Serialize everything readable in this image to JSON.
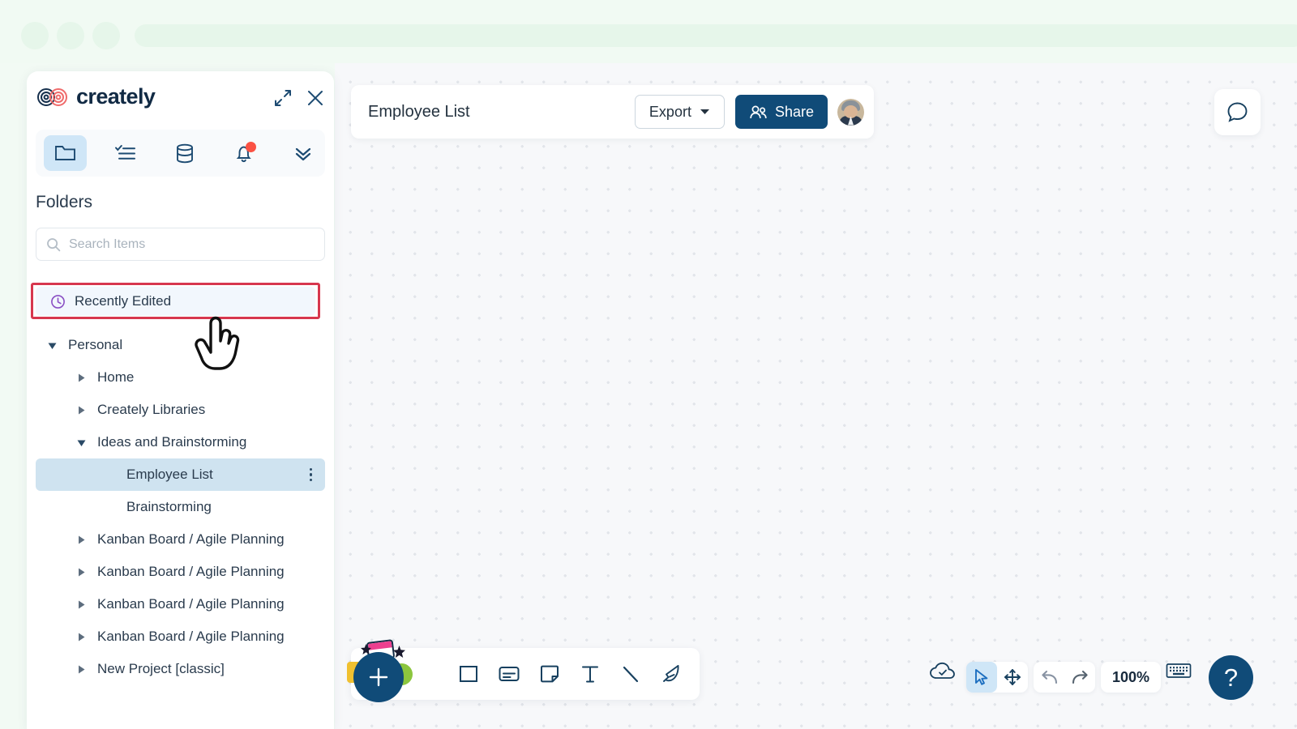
{
  "browser": {
    "dots": [
      "win-dot-1",
      "win-dot-2",
      "win-dot-3"
    ]
  },
  "panel": {
    "brand": "creately",
    "expand_icon": "expand-arrows-icon",
    "close_icon": "close-icon",
    "tabs": [
      {
        "name": "folder",
        "icon": "folder-icon",
        "active": true
      },
      {
        "name": "tasks",
        "icon": "task-list-icon",
        "active": false
      },
      {
        "name": "database",
        "icon": "database-icon",
        "active": false
      },
      {
        "name": "notifications",
        "icon": "bell-icon",
        "active": false,
        "badge": true
      },
      {
        "name": "more",
        "icon": "double-chevron-down-icon",
        "active": false
      }
    ],
    "section_title": "Folders",
    "search": {
      "placeholder": "Search Items",
      "value": "",
      "icon": "search-icon"
    },
    "recently_edited": {
      "label": "Recently Edited",
      "icon": "clock-icon",
      "highlighted": true
    },
    "tree": [
      {
        "label": "Personal",
        "indent": 0,
        "caret": "down",
        "selected": false,
        "menu": false
      },
      {
        "label": "Home",
        "indent": 1,
        "caret": "right",
        "selected": false,
        "menu": false
      },
      {
        "label": "Creately Libraries",
        "indent": 1,
        "caret": "right",
        "selected": false,
        "menu": false
      },
      {
        "label": "Ideas and Brainstorming",
        "indent": 1,
        "caret": "down",
        "selected": false,
        "menu": false
      },
      {
        "label": "Employee List",
        "indent": 2,
        "caret": "none",
        "selected": true,
        "menu": true
      },
      {
        "label": "Brainstorming",
        "indent": 2,
        "caret": "none",
        "selected": false,
        "menu": false
      },
      {
        "label": "Kanban Board / Agile Planning",
        "indent": 1,
        "caret": "right",
        "selected": false,
        "menu": false
      },
      {
        "label": "Kanban Board / Agile Planning",
        "indent": 1,
        "caret": "right",
        "selected": false,
        "menu": false
      },
      {
        "label": "Kanban Board / Agile Planning",
        "indent": 1,
        "caret": "right",
        "selected": false,
        "menu": false
      },
      {
        "label": "Kanban Board / Agile Planning",
        "indent": 1,
        "caret": "right",
        "selected": false,
        "menu": false
      },
      {
        "label": "New Project [classic]",
        "indent": 1,
        "caret": "right",
        "selected": false,
        "menu": false
      }
    ]
  },
  "header": {
    "document_title": "Employee List",
    "export_label": "Export",
    "export_caret": "chevron-down-icon",
    "share_label": "Share",
    "share_icon": "people-icon",
    "avatar": "user-avatar"
  },
  "chat": {
    "icon": "chat-bubble-icon"
  },
  "toolbar": {
    "add_icon": "plus-icon",
    "tools": [
      {
        "name": "rectangle",
        "icon": "rectangle-icon"
      },
      {
        "name": "card",
        "icon": "card-icon"
      },
      {
        "name": "note",
        "icon": "sticky-note-icon"
      },
      {
        "name": "text",
        "icon": "text-icon",
        "glyph": "T"
      },
      {
        "name": "line",
        "icon": "line-icon"
      },
      {
        "name": "freehand",
        "icon": "pen-icon"
      }
    ]
  },
  "controls": {
    "save_status_icon": "cloud-check-icon",
    "select_icon": "cursor-arrow-icon",
    "select_active": true,
    "pan_icon": "move-arrows-icon",
    "undo_icon": "undo-icon",
    "redo_icon": "redo-icon",
    "zoom_level": "100%",
    "keyboard_icon": "keyboard-icon",
    "help_label": "?"
  },
  "colors": {
    "brand_navy": "#104b78",
    "accent_red": "#d7374e",
    "notification_red": "#fb5244",
    "selected_blue": "#cfe3f0",
    "active_tab_blue": "#cfe6f7",
    "chrome_green": "#e6f6ea",
    "canvas_bg": "#f7f8fa"
  }
}
